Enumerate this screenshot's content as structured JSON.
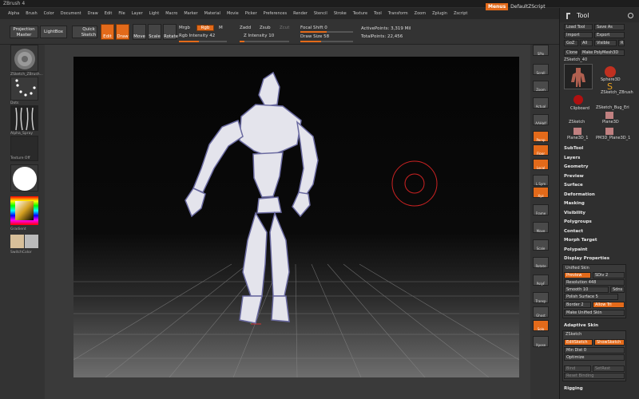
{
  "title": "ZBrush 4",
  "menus": [
    "Alpha",
    "Brush",
    "Color",
    "Document",
    "Draw",
    "Edit",
    "File",
    "Layer",
    "Light",
    "Macro",
    "Marker",
    "Material",
    "Movie",
    "Picker",
    "Preferences",
    "Render",
    "Stencil",
    "Stroke",
    "Texture",
    "Tool",
    "Transform",
    "Zoom",
    "Zplugin",
    "Zscript"
  ],
  "menu_right": {
    "menus": "Menus",
    "zscript": "DefaultZScript"
  },
  "toolbar": {
    "projection_master": "Projection Master",
    "lightbox": "LightBox",
    "quick_sketch": "Quick Sketch",
    "edit": "Edit",
    "draw": "Draw",
    "move": "Move",
    "scale": "Scale",
    "rotate": "Rotate",
    "mrgb": "Mrgb",
    "rgb": "Rgb",
    "m": "M",
    "rgb_intensity_label": "Rgb Intensity",
    "rgb_intensity": "42",
    "zadd": "Zadd",
    "zsub": "Zsub",
    "zcut": "Zcut",
    "z_intensity_label": "Z Intensity",
    "z_intensity": "10",
    "focal_shift_label": "Focal Shift",
    "focal_shift": "0",
    "draw_size_label": "Draw Size",
    "draw_size": "58",
    "active_points": "ActivePoints: 3,319 Mil",
    "total_points": "TotalPoints: 22,456"
  },
  "left_shelf": {
    "brush_label": "ZSketch_ZBrush...",
    "stroke_label": "Dots",
    "alpha_label": "Alpha_Spray",
    "texture_label": "Texture Off",
    "material_label": "",
    "gradient": "Gradient",
    "switch_color": "SwitchColor"
  },
  "right_shelf": [
    "SPix",
    "Scroll",
    "Zoom",
    "Actual",
    "AAHalf",
    "Persp",
    "Floor",
    "Local",
    "L.Sym",
    "Xyz",
    "Frame",
    "Move",
    "Scale",
    "Rotate",
    "PolyF",
    "Transp",
    "Ghost",
    "Solo",
    "Xpose"
  ],
  "tool": {
    "title": "Tool",
    "load_tool": "Load Tool",
    "save_as": "Save As",
    "import": "Import",
    "export": "Export",
    "goz": "GoZ",
    "all": "All",
    "visible": "Visible",
    "r": "R",
    "clone": "Clone",
    "make_polymesh": "Make PolyMesh3D",
    "current_tool": "ZSketch_40",
    "thumbs": [
      "",
      "Sphere3D",
      "ZSketch_ZBrush",
      "Clipboard",
      "ZSketch_Bug_Eri",
      "ZSketch",
      "Plane3D",
      "Plane3D_1",
      "PM3D_Plane3D_1"
    ],
    "sections": [
      "SubTool",
      "Layers",
      "Geometry",
      "Preview",
      "Surface",
      "Deformation",
      "Masking",
      "Visibility",
      "Polygroups",
      "Contact",
      "Morph Target",
      "Polypaint",
      "Display Properties"
    ],
    "unified_skin": {
      "header": "Unified Skin",
      "preview": "Preview",
      "sdiv": "SDiv 2",
      "resolution": "Resolution 448",
      "smooth": "Smooth 10",
      "sdns": "Sdns",
      "polish_surface": "Polish Surface 5",
      "border": "Border 2",
      "allow_tri": "Allow Tri",
      "make_unified_skin": "Make Unified Skin"
    },
    "adaptive_skin": "Adaptive Skin",
    "zsketch": {
      "header": "ZSketch",
      "edit_sketch": "EditSketch",
      "show_sketch": "ShowSketch",
      "min_dist": "Min Dist 0",
      "optimize": "Optimize",
      "bind": "Bind",
      "set_rest": "SetRest",
      "reset_binding": "Reset Binding"
    },
    "rigging": "Rigging"
  },
  "colors": {
    "accent": "#e36a1a",
    "panel": "#2f2f2f",
    "viewport_top": "#050505"
  }
}
